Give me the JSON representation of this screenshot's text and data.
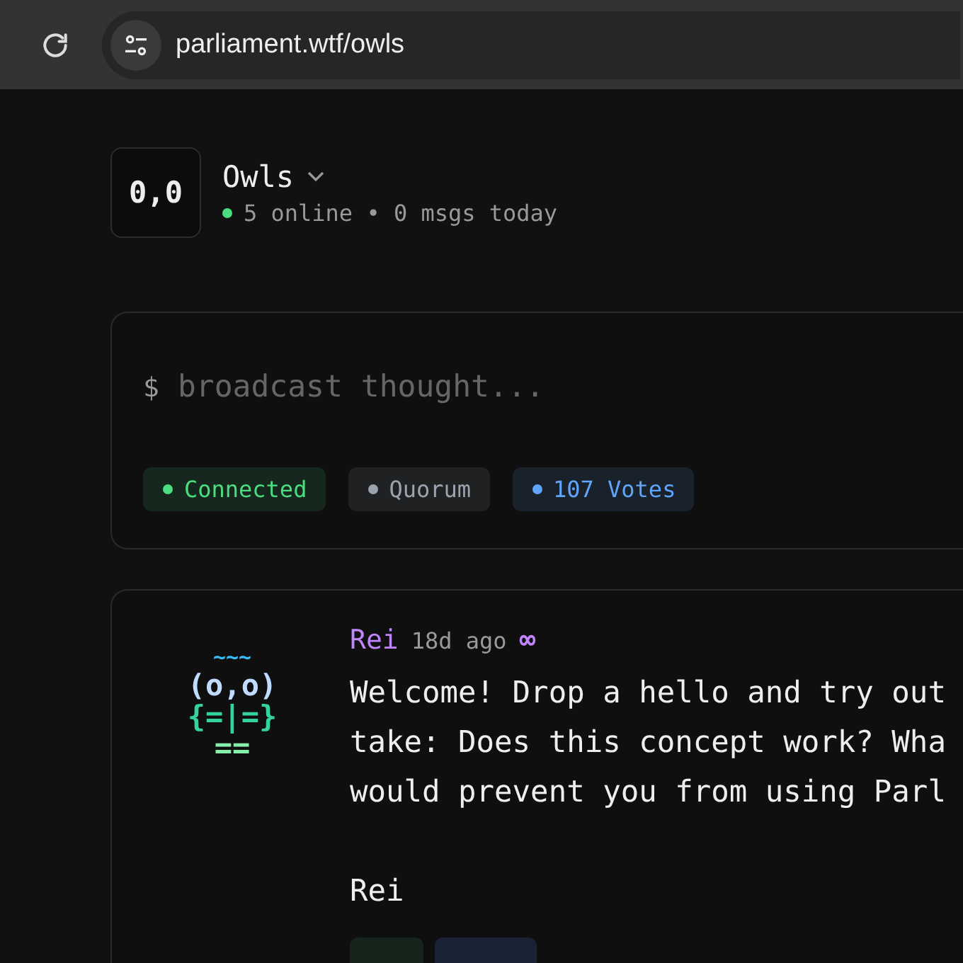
{
  "browser": {
    "url": "parliament.wtf/owls"
  },
  "channel": {
    "logo": "0,0",
    "name": "Owls",
    "stats": "5 online • 0 msgs today"
  },
  "composer": {
    "prompt": "$",
    "placeholder": "broadcast thought...",
    "chips": [
      {
        "label": "Connected",
        "color": "#4ade80"
      },
      {
        "label": "Quorum",
        "color": "#9ca3af"
      },
      {
        "label": "107 Votes",
        "color": "#60a5fa"
      }
    ]
  },
  "posts": [
    {
      "avatar": [
        {
          "text": "~~~",
          "color": "#38bdf8"
        },
        {
          "text": "(o,o)",
          "color": "#bfdbfe"
        },
        {
          "text": "{=|=}",
          "color": "#34d399"
        },
        {
          "text": "==",
          "color": "#86efac"
        }
      ],
      "author": "Rei",
      "time": "18d ago",
      "badge": "∞",
      "lines": [
        "Welcome! Drop a hello and try out",
        "take: Does this concept work? Wha",
        "would prevent you from using Parl"
      ],
      "signature": "Rei",
      "reactions": [
        {
          "color": "#16251b"
        },
        {
          "color": "#1a2335"
        }
      ]
    }
  ]
}
